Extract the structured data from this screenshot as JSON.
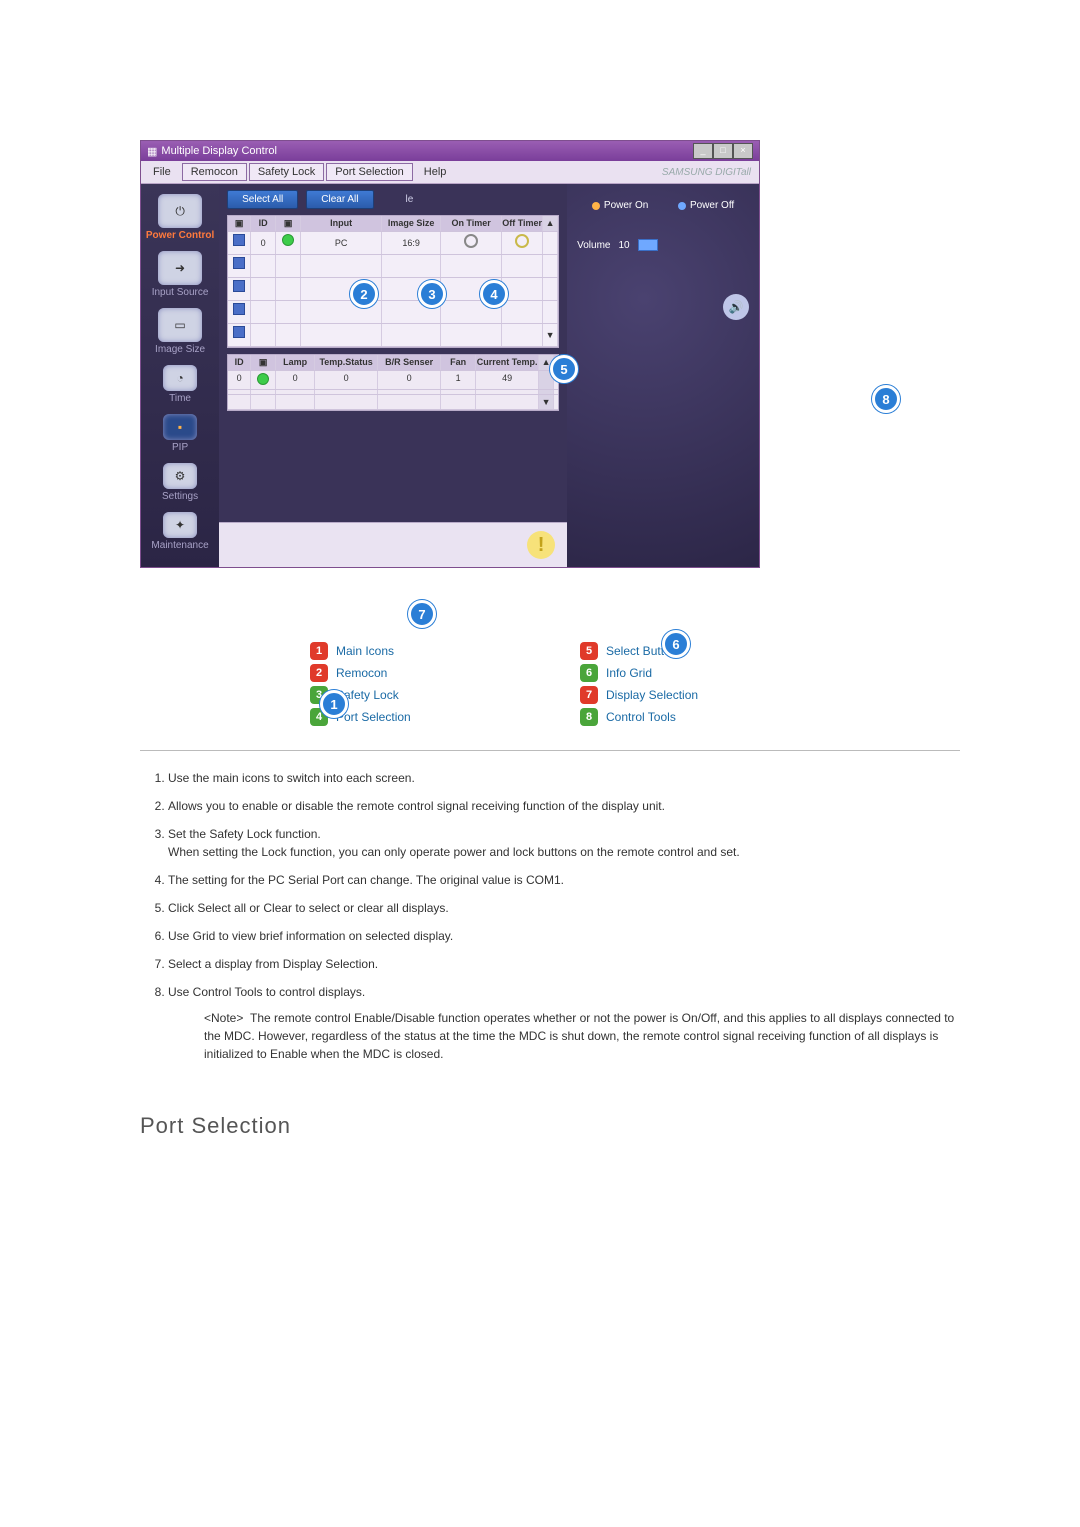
{
  "window": {
    "title": "Multiple Display Control",
    "brand": "SAMSUNG DIGITall"
  },
  "menu": {
    "file": "File",
    "remocon": "Remocon",
    "safety_lock": "Safety Lock",
    "port_selection": "Port Selection",
    "help": "Help"
  },
  "sidebar": {
    "power_control": "Power Control",
    "input_source": "Input Source",
    "image_size": "Image Size",
    "time": "Time",
    "pip": "PIP",
    "settings": "Settings",
    "maintenance": "Maintenance"
  },
  "toolbar": {
    "select_all": "Select All",
    "clear_all": "Clear All",
    "extra": "le"
  },
  "grid1": {
    "headers": {
      "id": "ID",
      "input": "Input",
      "image_size": "Image Size",
      "on_timer": "On Timer",
      "off_timer": "Off Timer"
    },
    "row": {
      "id": "0",
      "input": "PC",
      "image_size": "16:9"
    }
  },
  "grid2": {
    "headers": {
      "id": "ID",
      "lamp": "Lamp",
      "temp_status": "Temp.Status",
      "br_sensor": "B/R Senser",
      "fan": "Fan",
      "current_temp": "Current Temp."
    },
    "row": {
      "id": "0",
      "lamp": "0",
      "temp_status": "0",
      "br_sensor": "0",
      "fan": "1",
      "current_temp": "49"
    }
  },
  "control_panel": {
    "power_on": "Power On",
    "power_off": "Power Off",
    "volume_label": "Volume",
    "volume_value": "10"
  },
  "legend": {
    "1": "Main Icons",
    "2": "Remocon",
    "3": "Safety Lock",
    "4": "Port Selection",
    "5": "Select Button",
    "6": "Info Grid",
    "7": "Display Selection",
    "8": "Control Tools"
  },
  "descriptions": {
    "1": "Use the main icons to switch into each screen.",
    "2": "Allows you to enable or disable the remote control signal receiving function of the display unit.",
    "3a": "Set the Safety Lock function.",
    "3b": "When setting the Lock function, you can only operate power and lock buttons on the remote control and set.",
    "4": "The setting for the PC Serial Port can change. The original value is COM1.",
    "5": "Click Select all or Clear to select or clear all displays.",
    "6": "Use Grid to view brief information on selected display.",
    "7": "Select a display from Display Selection.",
    "8": "Use Control Tools to control displays.",
    "note_label": "<Note>",
    "note_body": "The remote control Enable/Disable function operates whether or not the power is On/Off, and this applies to all displays connected to the MDC. However, regardless of the status at the time the MDC is shut down, the remote control signal receiving function of all displays is initialized to Enable when the MDC is closed."
  },
  "section_title": "Port Selection"
}
